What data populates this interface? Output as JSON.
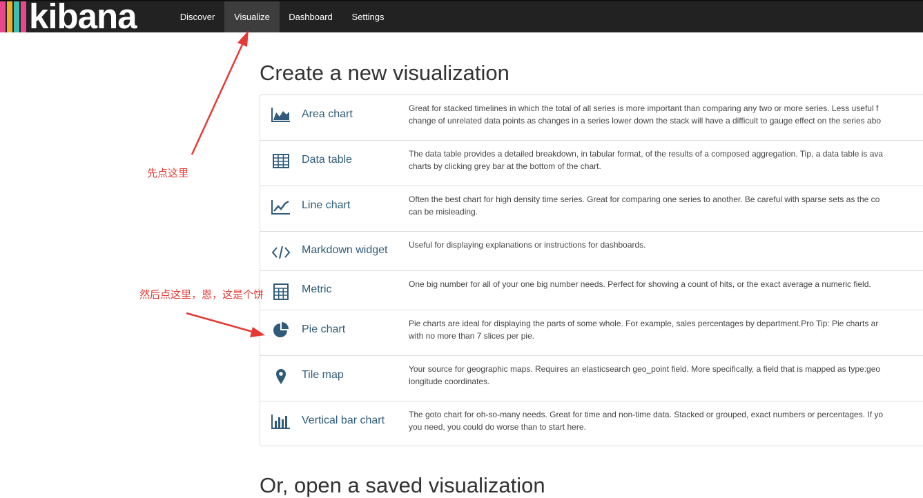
{
  "app": {
    "logo_text": "kibana",
    "logo_colors": [
      "#e8478b",
      "#f0ad2a",
      "#3ebeb0",
      "#e8478b"
    ],
    "accent_link": "#2f5b78"
  },
  "nav": {
    "items": [
      {
        "label": "Discover",
        "active": false
      },
      {
        "label": "Visualize",
        "active": true
      },
      {
        "label": "Dashboard",
        "active": false
      },
      {
        "label": "Settings",
        "active": false
      }
    ]
  },
  "page": {
    "title": "Create a new visualization",
    "next_section_title": "Or, open a saved visualization"
  },
  "visualizations": [
    {
      "icon": "area-chart-icon",
      "label": "Area chart",
      "desc": "Great for stacked timelines in which the total of all series is more important than comparing any two or more series. Less useful f\nchange of unrelated data points as changes in a series lower down the stack will have a difficult to gauge effect on the series abo"
    },
    {
      "icon": "table-icon",
      "label": "Data table",
      "desc": "The data table provides a detailed breakdown, in tabular format, of the results of a composed aggregation. Tip, a data table is ava\ncharts by clicking grey bar at the bottom of the chart."
    },
    {
      "icon": "line-chart-icon",
      "label": "Line chart",
      "desc": "Often the best chart for high density time series. Great for comparing one series to another. Be careful with sparse sets as the co\ncan be misleading."
    },
    {
      "icon": "code-icon",
      "label": "Markdown widget",
      "desc": "Useful for displaying explanations or instructions for dashboards."
    },
    {
      "icon": "calculator-icon",
      "label": "Metric",
      "desc": "One big number for all of your one big number needs. Perfect for showing a count of hits, or the exact average a numeric field."
    },
    {
      "icon": "pie-chart-icon",
      "label": "Pie chart",
      "desc": "Pie charts are ideal for displaying the parts of some whole. For example, sales percentages by department.Pro Tip: Pie charts ar\nwith no more than 7 slices per pie."
    },
    {
      "icon": "map-marker-icon",
      "label": "Tile map",
      "desc": "Your source for geographic maps. Requires an elasticsearch geo_point field. More specifically, a field that is mapped as type:geo\nlongitude coordinates."
    },
    {
      "icon": "bar-chart-icon",
      "label": "Vertical bar chart",
      "desc": "The goto chart for oh-so-many needs. Great for time and non-time data. Stacked or grouped, exact numbers or percentages. If yo\nyou need, you could do worse than to start here."
    }
  ],
  "annotations": {
    "note1": "先点这里",
    "note2": "然后点这里，恩，这是个饼",
    "color": "#e53935"
  }
}
